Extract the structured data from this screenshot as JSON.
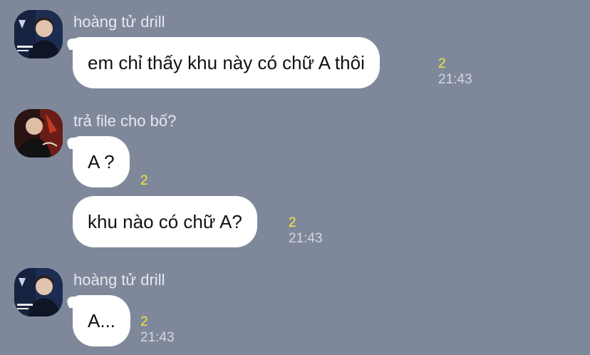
{
  "messages": [
    {
      "sender": "hoàng tử drill",
      "bubbles": [
        {
          "text": "em chỉ thấy khu này có chữ A thôi",
          "read": "2",
          "time": "21:43"
        }
      ]
    },
    {
      "sender": "trả file cho bố?",
      "bubbles": [
        {
          "text": "A ?",
          "read": "2",
          "time": ""
        },
        {
          "text": "khu nào có chữ A?",
          "read": "2",
          "time": "21:43"
        }
      ]
    },
    {
      "sender": "hoàng tử drill",
      "bubbles": [
        {
          "text": "A...",
          "read": "2",
          "time": "21:43"
        }
      ]
    }
  ],
  "colors": {
    "background": "#7f889b",
    "bubble": "#ffffff",
    "read_count": "#f5e83a",
    "timestamp": "#d4d8e0",
    "sender_name": "#e5e8ef"
  },
  "icons": [
    "user-avatar-photo"
  ]
}
